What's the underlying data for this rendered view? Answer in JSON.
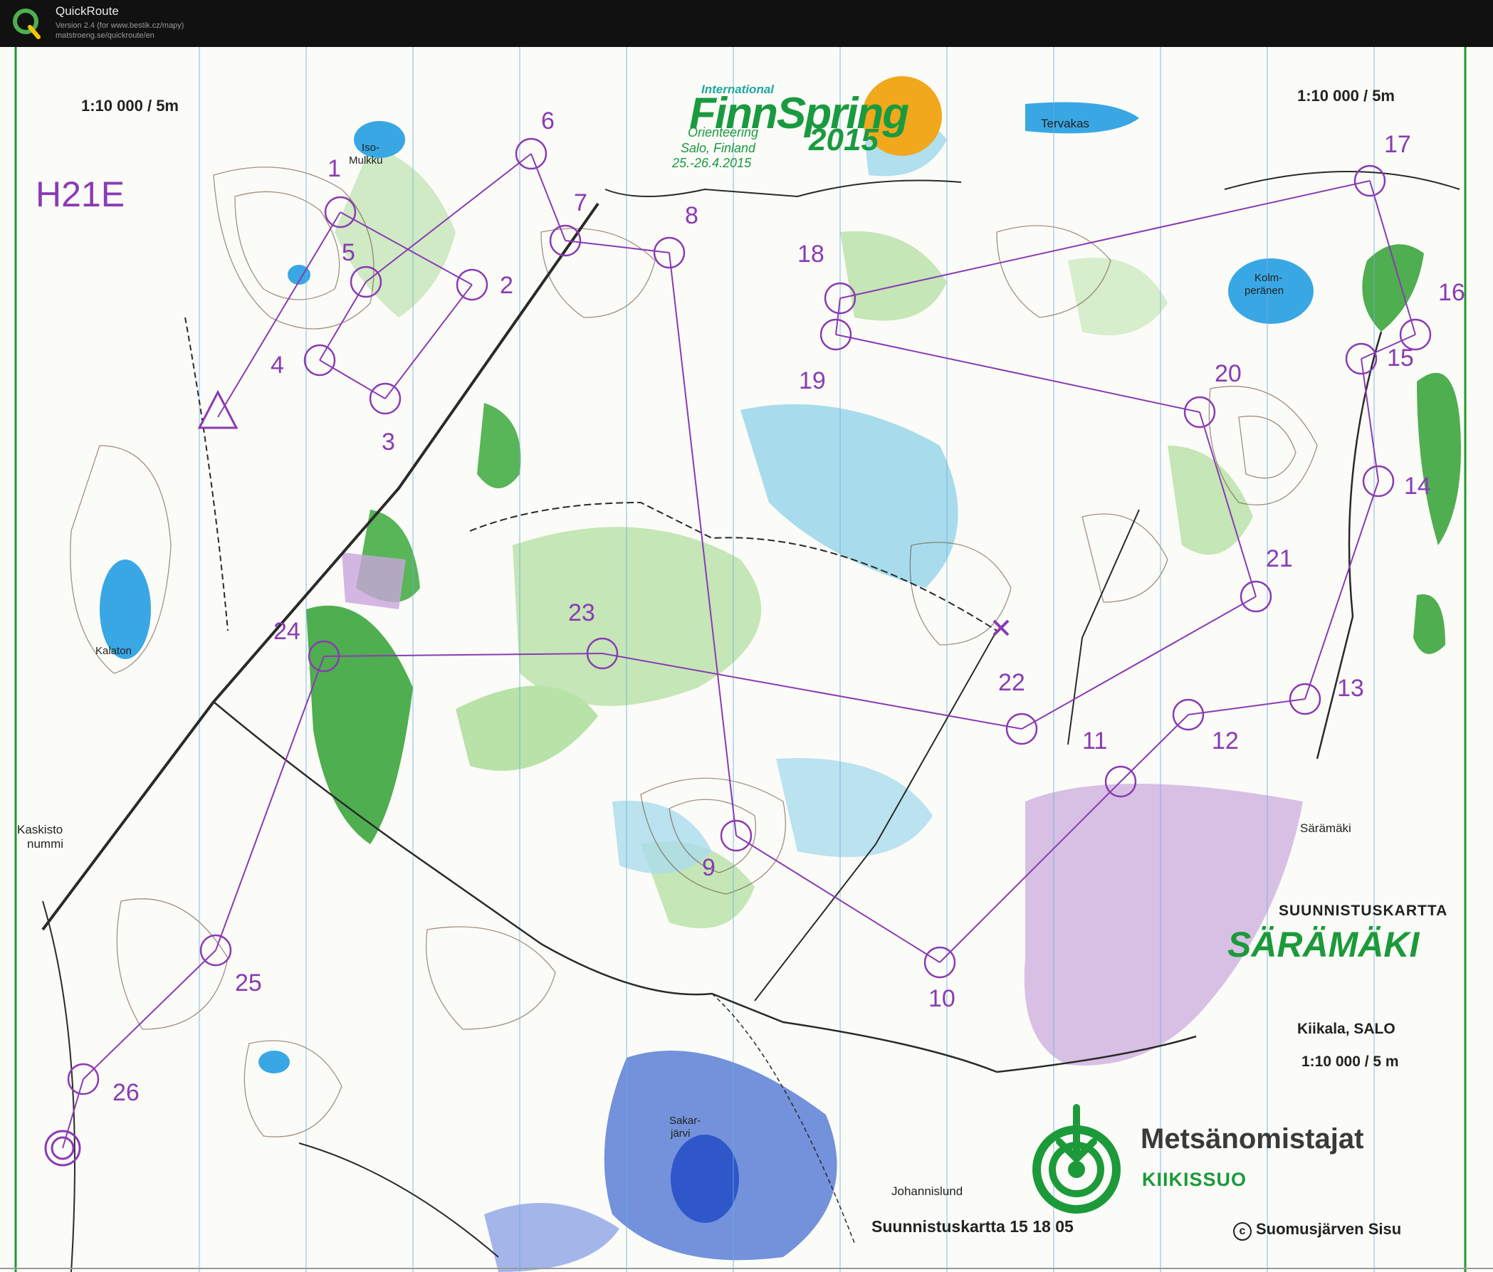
{
  "app": {
    "title": "QuickRoute",
    "version": "Version 2.4  (for www.bestik.cz/mapy)",
    "url": "matstroeng.se/quickroute/en"
  },
  "map": {
    "scale_top_left": "1:10 000 / 5m",
    "scale_top_right": "1:10 000 / 5m",
    "class_label": "H21E",
    "event": {
      "top_line": "International",
      "name_line": "FinnSpring",
      "sub_line": "Orienteering",
      "year": "2015",
      "city": "Salo, Finland",
      "dates": "25.-26.4.2015"
    },
    "lake_labels": {
      "iso": "Iso-",
      "mulkku": "Mulkku",
      "kalaton": "Kalaton",
      "kolm": "Kolm-",
      "peranen": "peränen",
      "sakar": "Sakar-",
      "jarvi": "järvi"
    },
    "place_labels": {
      "tervakas": "Tervakas",
      "kaskisto": "Kaskisto",
      "nummi": "nummi",
      "saramaki_small": "Särämäki",
      "johannislund": "Johannislund"
    },
    "info": {
      "title": "SUUNNISTUSKARTTA",
      "area_name": "SÄRÄMÄKI",
      "location": "Kiikala, SALO",
      "scale": "1:10 000 / 5 m",
      "sponsor": "Metsänomistajat",
      "sponsor_sub": "KIIKISSUO",
      "map_number": "Suunnistuskartta 15 18 05",
      "copyright_symbol": "c",
      "copyright": "Suomusjärven Sisu"
    },
    "controls": [
      {
        "label": "1"
      },
      {
        "label": "2"
      },
      {
        "label": "3"
      },
      {
        "label": "4"
      },
      {
        "label": "5"
      },
      {
        "label": "6"
      },
      {
        "label": "7"
      },
      {
        "label": "8"
      },
      {
        "label": "9"
      },
      {
        "label": "10"
      },
      {
        "label": "11"
      },
      {
        "label": "12"
      },
      {
        "label": "13"
      },
      {
        "label": "14"
      },
      {
        "label": "15"
      },
      {
        "label": "16"
      },
      {
        "label": "17"
      },
      {
        "label": "18"
      },
      {
        "label": "19"
      },
      {
        "label": "20"
      },
      {
        "label": "21"
      },
      {
        "label": "22"
      },
      {
        "label": "23"
      },
      {
        "label": "24"
      },
      {
        "label": "25"
      },
      {
        "label": "26"
      }
    ],
    "colors": {
      "course": "#8a3bb3",
      "water": "#39a7e4",
      "marsh": "#9fd8ea",
      "green": "#4fae4f",
      "light_green": "#b8e2a8",
      "contour": "#5a3a22",
      "event_sun": "#f2a81c"
    }
  }
}
